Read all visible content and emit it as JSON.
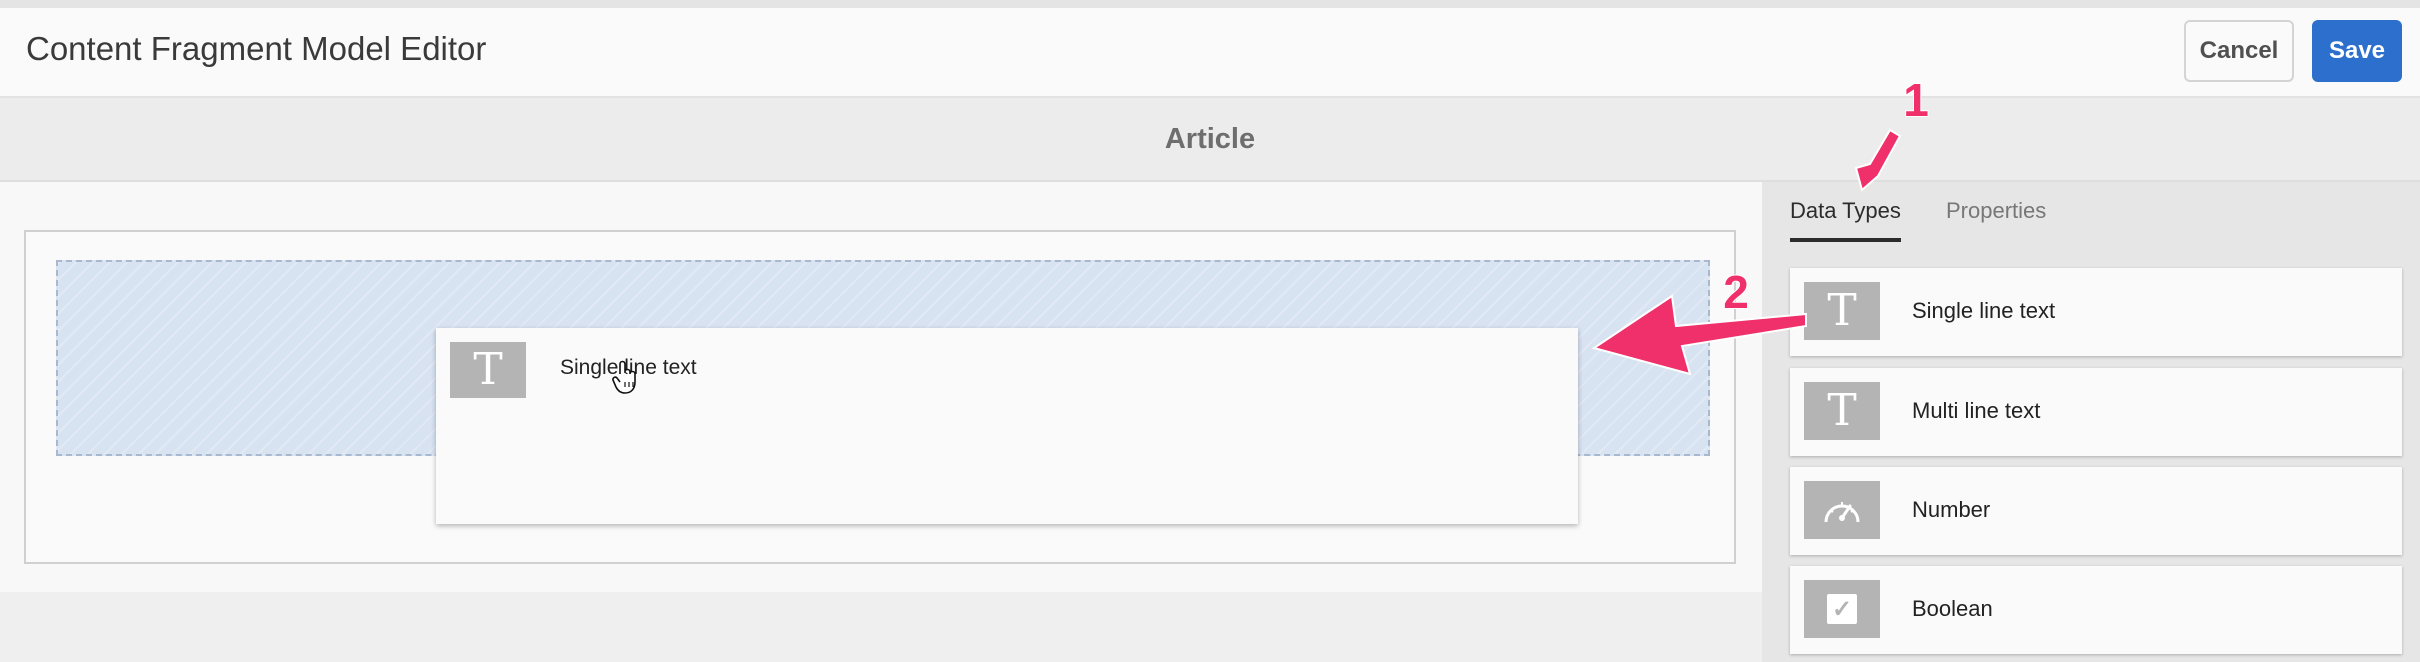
{
  "header": {
    "app_title": "Content Fragment Model Editor",
    "cancel_label": "Cancel",
    "save_label": "Save"
  },
  "model": {
    "title": "Article"
  },
  "canvas": {
    "dragged_item": {
      "label": "Single line text",
      "icon": "text-t-icon"
    }
  },
  "panel": {
    "tabs": [
      {
        "label": "Data Types",
        "active": true
      },
      {
        "label": "Properties",
        "active": false
      }
    ],
    "data_types": [
      {
        "label": "Single line text",
        "icon": "text-t-icon"
      },
      {
        "label": "Multi line text",
        "icon": "text-t-icon"
      },
      {
        "label": "Number",
        "icon": "gauge-icon"
      },
      {
        "label": "Boolean",
        "icon": "checkbox-icon"
      }
    ]
  },
  "annotations": [
    {
      "label": "1"
    },
    {
      "label": "2"
    }
  ],
  "colors": {
    "accent": "#2c6fcd",
    "annotation": "#f0306a",
    "icon_bg": "#b4b4b4",
    "drop_zone": "#d8e3f1"
  }
}
